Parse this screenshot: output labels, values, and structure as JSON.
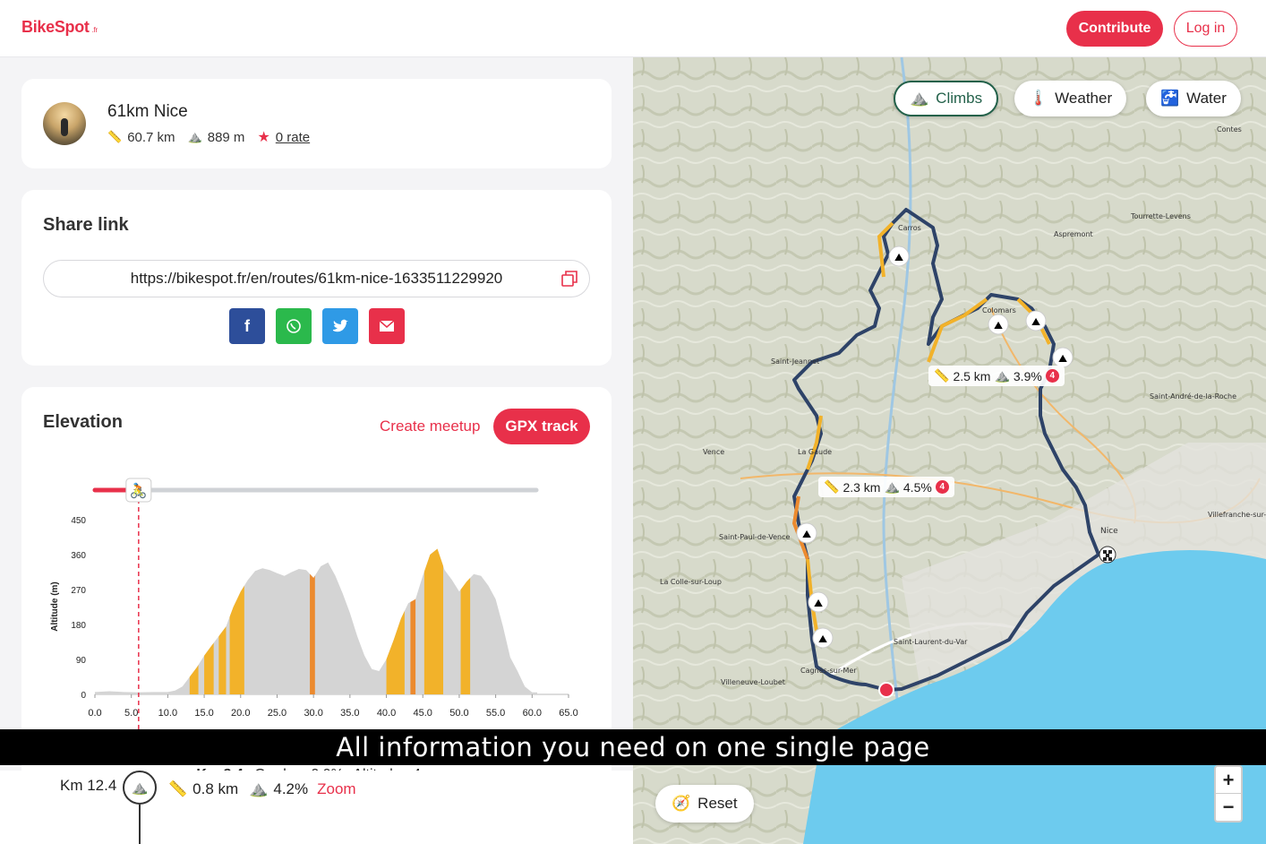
{
  "header": {
    "logo": "BikeSpot",
    "logo_suffix": ".fr",
    "contribute_label": "Contribute",
    "login_label": "Log in"
  },
  "route": {
    "title": "61km Nice",
    "distance": "60.7 km",
    "elevation": "889 m",
    "rating": "0 rate"
  },
  "share": {
    "title": "Share link",
    "url": "https://bikespot.fr/en/routes/61km-nice-1633511229920",
    "buttons": [
      "f",
      "whatsapp",
      "twitter",
      "email"
    ]
  },
  "elevation": {
    "title": "Elevation",
    "create_meetup_label": "Create meetup",
    "gpx_label": "GPX track",
    "info_km": "Km 8.4",
    "info_grade": "Grade : -0.9%",
    "info_altitude": "Altitude : 4 m"
  },
  "chart_data": {
    "type": "area",
    "title": "",
    "xlabel": "",
    "ylabel": "Altitude (m)",
    "xlim": [
      0,
      65
    ],
    "ylim": [
      0,
      450
    ],
    "x_ticks": [
      "0.0",
      "5.0",
      "10.0",
      "15.0",
      "20.0",
      "25.0",
      "30.0",
      "35.0",
      "40.0",
      "45.0",
      "50.0",
      "55.0",
      "60.0",
      "65.0"
    ],
    "y_ticks": [
      "0",
      "90",
      "180",
      "270",
      "360",
      "450"
    ],
    "x": [
      0,
      2,
      4,
      6,
      8,
      10,
      11,
      12,
      13,
      14,
      15,
      16,
      17,
      18,
      19,
      20,
      21,
      22,
      23,
      24,
      25,
      26,
      27,
      28,
      29,
      30,
      31,
      32,
      33,
      34,
      35,
      36,
      37,
      38,
      39,
      40,
      41,
      42,
      43,
      44,
      45,
      46,
      47,
      48,
      49,
      50,
      51,
      52,
      53,
      54,
      55,
      56,
      57,
      58,
      59,
      60,
      60.7
    ],
    "y": [
      6,
      8,
      6,
      5,
      6,
      6,
      10,
      20,
      45,
      70,
      100,
      125,
      150,
      175,
      225,
      265,
      295,
      318,
      325,
      320,
      312,
      305,
      315,
      323,
      320,
      300,
      330,
      340,
      305,
      260,
      210,
      150,
      100,
      65,
      60,
      90,
      140,
      195,
      235,
      245,
      305,
      360,
      375,
      320,
      295,
      265,
      290,
      310,
      305,
      280,
      245,
      175,
      95,
      60,
      20,
      5,
      5
    ],
    "climb_segments": [
      [
        13,
        14.2
      ],
      [
        15,
        16.3
      ],
      [
        17,
        18
      ],
      [
        18.5,
        20.5
      ],
      [
        29.5,
        30.2
      ],
      [
        40,
        42.5
      ],
      [
        43.3,
        44
      ],
      [
        45.2,
        47.8
      ],
      [
        50.2,
        51.5
      ]
    ],
    "cursor_km": 6,
    "colors": {
      "area": "#d4d4d4",
      "climb_yellow": "#f2b22a",
      "climb_orange": "#ec8a2e",
      "cursor": "#e8304a"
    }
  },
  "climb_list": {
    "km": "Km 12.4",
    "distance": "0.8 km",
    "grade": "4.2%",
    "zoom_label": "Zoom"
  },
  "map": {
    "chip_climbs": "Climbs",
    "chip_weather": "Weather",
    "chip_water": "Water",
    "label1_dist": "2.5 km",
    "label1_grade": "3.9%",
    "label1_cat": "4",
    "label2_dist": "2.3 km",
    "label2_grade": "4.5%",
    "label2_cat": "4",
    "reset_label": "Reset",
    "zoom_in": "+",
    "zoom_out": "−",
    "place_names": [
      "Carros",
      "Saint-Jeannet",
      "La Gaude",
      "Vence",
      "Saint-Paul-de-Vence",
      "La Colle-sur-Loup",
      "Cagnes-sur-Mer",
      "Villeneuve-Loubet",
      "Saint-Laurent-du-Var",
      "Nice",
      "Aspremont",
      "Tourrette-Levens",
      "Saint-André-de-la-Roche",
      "Villefranche-sur-Mer",
      "Colomars",
      "Contes"
    ]
  },
  "banner": {
    "text": "All information you need on one single page"
  }
}
